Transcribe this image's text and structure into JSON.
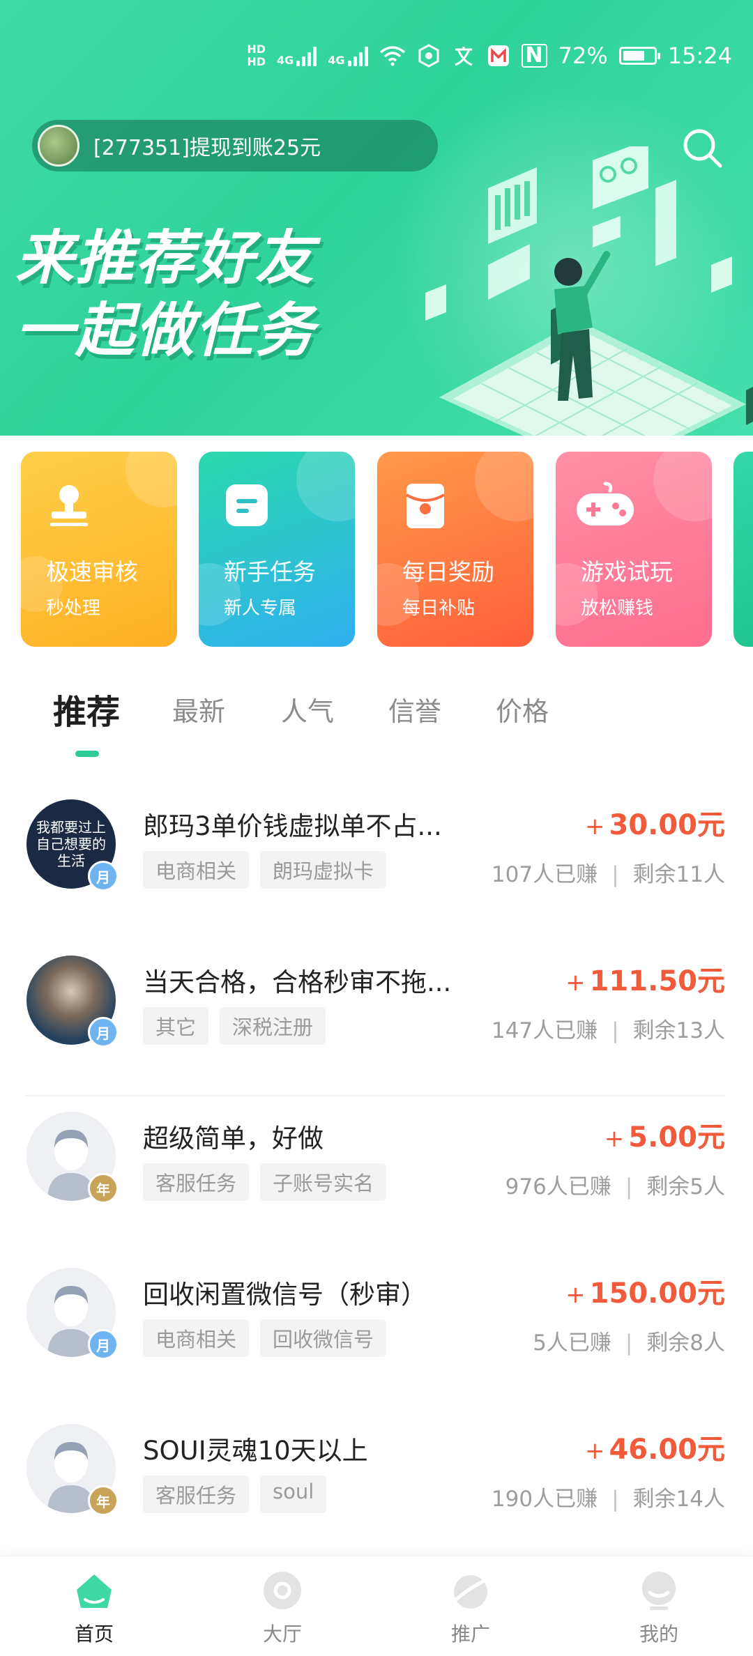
{
  "status_bar": {
    "hd1": "HD",
    "hd2": "HD",
    "net1": "4G",
    "net2": "4G",
    "nfc": "N",
    "battery_percent": "72%",
    "battery_level": 0.72,
    "time": "15:24"
  },
  "header": {
    "notice_text": "[277351]提现到账25元",
    "slogan_line1": "来推荐好友",
    "slogan_line2": "一起做任务"
  },
  "categories": [
    {
      "title": "极速审核",
      "subtitle": "秒处理",
      "icon": "stamp-icon"
    },
    {
      "title": "新手任务",
      "subtitle": "新人专属",
      "icon": "note-icon"
    },
    {
      "title": "每日奖励",
      "subtitle": "每日补贴",
      "icon": "red-envelope-icon"
    },
    {
      "title": "游戏试玩",
      "subtitle": "放松赚钱",
      "icon": "gamepad-icon"
    }
  ],
  "tabs": [
    "推荐",
    "最新",
    "人气",
    "信誉",
    "价格"
  ],
  "tasks": [
    {
      "title": "郎玛3单价钱虚拟单不占...",
      "price_prefix": "+",
      "price": "30.00元",
      "tags": [
        "电商相关",
        "朗玛虚拟卡"
      ],
      "earned": "107人已赚",
      "remaining": "剩余11人",
      "badge": "月",
      "avatar_text": "我都要过上自己想要的生活"
    },
    {
      "title": "当天合格，合格秒审不拖...",
      "price_prefix": "+",
      "price": "111.50元",
      "tags": [
        "其它",
        "深税注册"
      ],
      "earned": "147人已赚",
      "remaining": "剩余13人",
      "badge": "月"
    },
    {
      "title": "超级简单，好做",
      "price_prefix": "+",
      "price": "5.00元",
      "tags": [
        "客服任务",
        "子账号实名"
      ],
      "earned": "976人已赚",
      "remaining": "剩余5人",
      "badge": "年"
    },
    {
      "title": "回收闲置微信号（秒审）",
      "price_prefix": "+",
      "price": "150.00元",
      "tags": [
        "电商相关",
        "回收微信号"
      ],
      "earned": "5人已赚",
      "remaining": "剩余8人",
      "badge": "月"
    },
    {
      "title": "SOUI灵魂10天以上",
      "price_prefix": "+",
      "price": "46.00元",
      "tags": [
        "客服任务",
        "soul"
      ],
      "earned": "190人已赚",
      "remaining": "剩余14人",
      "badge": "年"
    }
  ],
  "stats_separator": "|",
  "bottom_nav": [
    {
      "label": "首页",
      "icon": "home-icon",
      "active": true
    },
    {
      "label": "大厅",
      "icon": "hall-icon",
      "active": false
    },
    {
      "label": "推广",
      "icon": "promote-icon",
      "active": false
    },
    {
      "label": "我的",
      "icon": "profile-icon",
      "active": false
    }
  ],
  "colors": {
    "brand_green": "#2dcc95",
    "price_red": "#f15a3b"
  }
}
